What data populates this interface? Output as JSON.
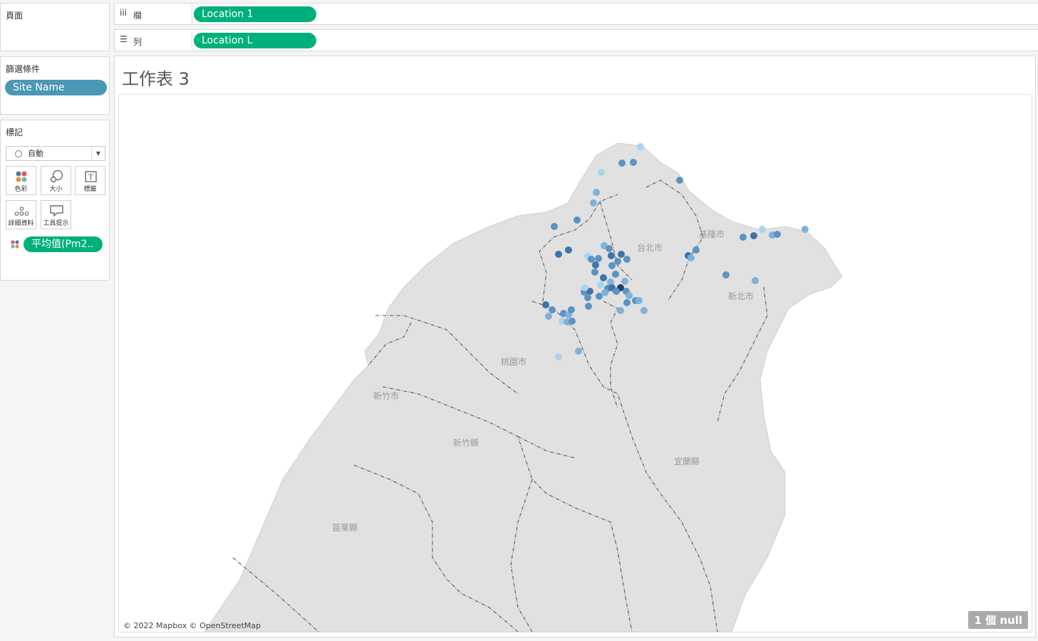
{
  "pages_card": {
    "title": "頁面"
  },
  "filters_card": {
    "title": "篩選條件",
    "pill": "Site Name"
  },
  "marks_card": {
    "title": "標記",
    "mark_type": "自動",
    "buttons": [
      {
        "label": "色彩",
        "icon": "color-icon"
      },
      {
        "label": "大小",
        "icon": "size-icon"
      },
      {
        "label": "標籤",
        "icon": "label-icon"
      },
      {
        "label": "詳細資料",
        "icon": "detail-icon"
      },
      {
        "label": "工具提示",
        "icon": "tooltip-icon"
      }
    ],
    "color_pill": "平均值(Pm2.."
  },
  "columns_shelf": {
    "name": "欄",
    "pill": "Location 1"
  },
  "rows_shelf": {
    "name": "列",
    "pill": "Location L"
  },
  "sheet": {
    "title": "工作表 3",
    "attribution": "© 2022 Mapbox © OpenStreetMap",
    "null_badge": "1 個 null"
  },
  "map": {
    "labels": [
      "台北市",
      "基隆市",
      "新北市",
      "桃園市",
      "新竹市",
      "新竹縣",
      "宜蘭縣",
      "苗栗縣"
    ],
    "color_scale": {
      "low": "#a9d4ee",
      "mid": "#5b93c2",
      "high": "#1f3f66"
    }
  },
  "colors": {
    "filter_pill": "#4a98b6",
    "field_pill": "#00b07c"
  }
}
